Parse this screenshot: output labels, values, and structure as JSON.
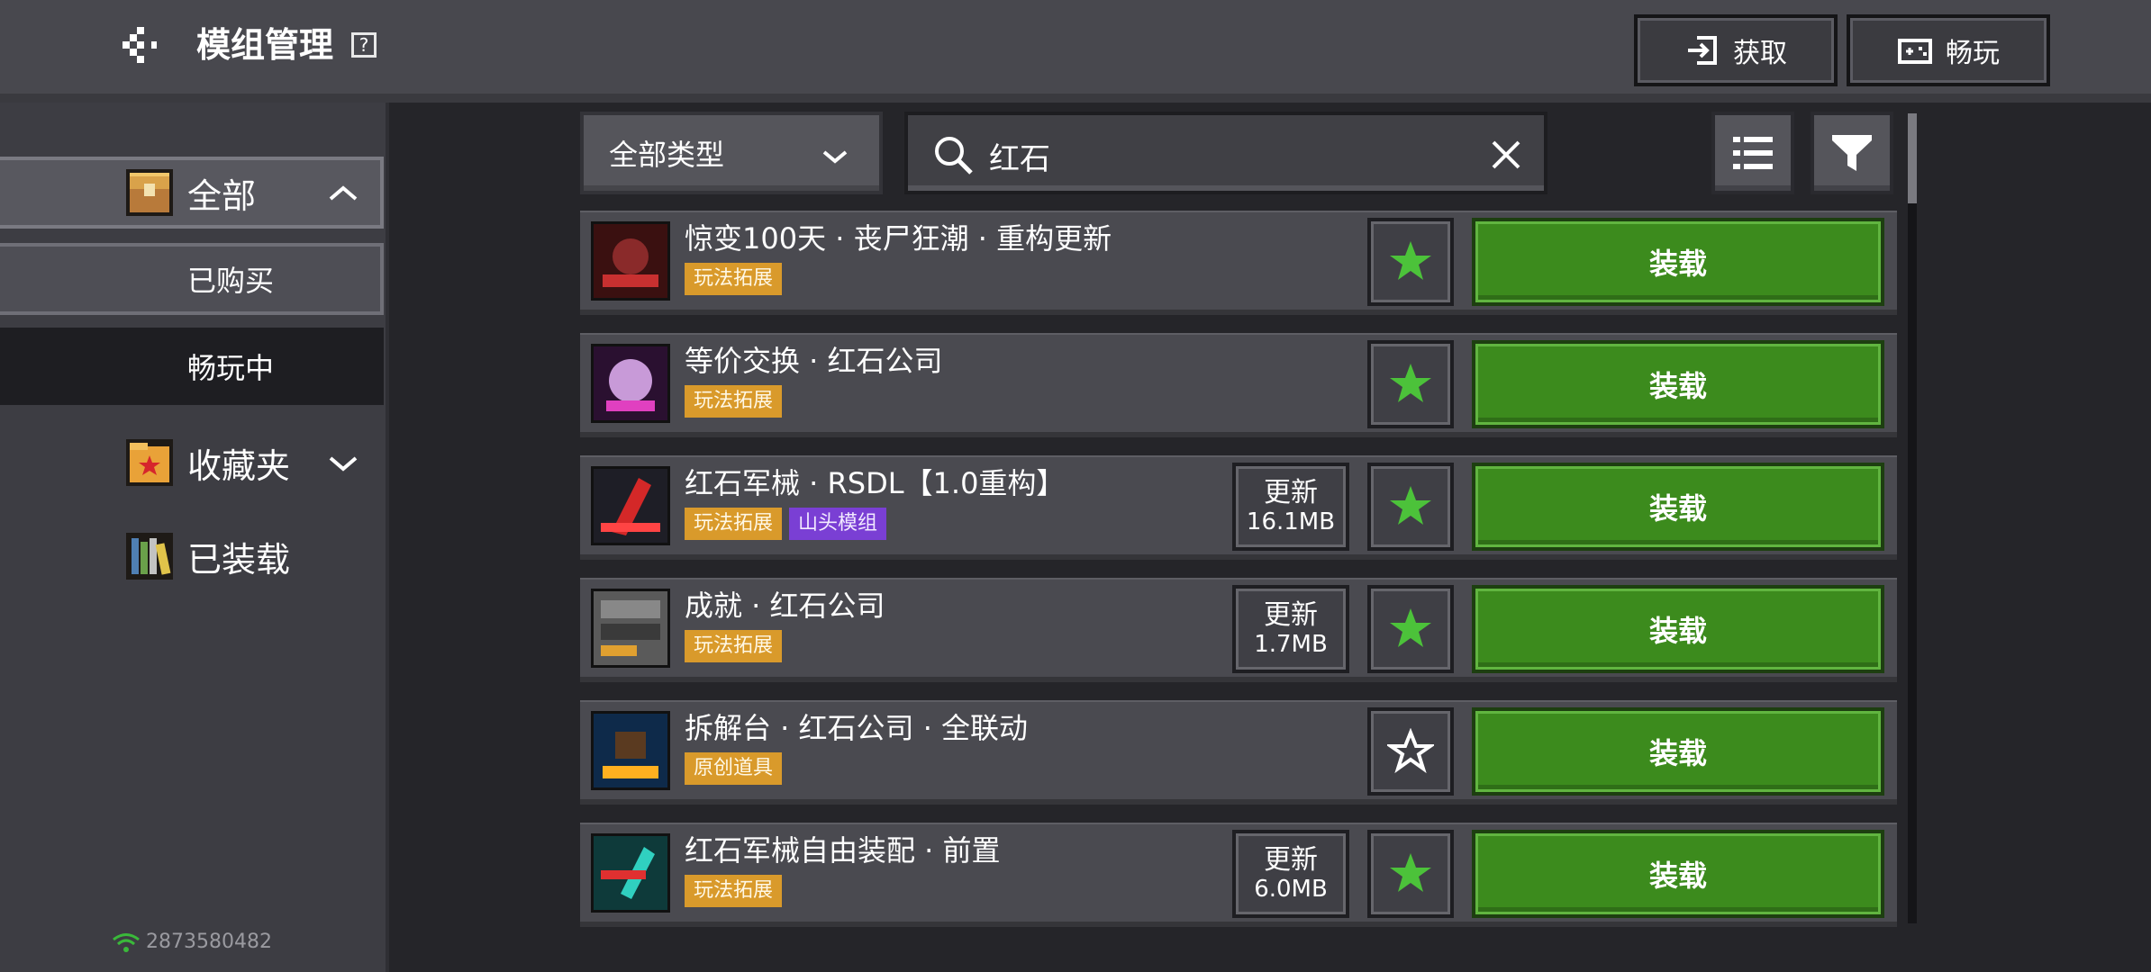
{
  "header": {
    "title": "模组管理",
    "help_label": "?",
    "get_label": "获取",
    "play_label": "畅玩"
  },
  "sidebar": {
    "items": [
      {
        "label": "全部"
      },
      {
        "label": "已购买"
      },
      {
        "label": "畅玩中"
      },
      {
        "label": "收藏夹"
      },
      {
        "label": "已装载"
      }
    ],
    "account_id": "2873580482"
  },
  "toolbar": {
    "type_filter": "全部类型",
    "search_value": "红石"
  },
  "mods": [
    {
      "title": "惊变100天 · 丧尸狂潮 · 重构更新",
      "tags": [
        "玩法拓展"
      ],
      "favorited": true,
      "install_label": "装载"
    },
    {
      "title": "等价交换 · 红石公司",
      "tags": [
        "玩法拓展"
      ],
      "favorited": true,
      "install_label": "装载"
    },
    {
      "title": "红石军械 · RSDL【1.0重构】",
      "tags": [
        "玩法拓展",
        "山头模组"
      ],
      "update": {
        "label": "更新",
        "size": "16.1MB"
      },
      "favorited": true,
      "install_label": "装载"
    },
    {
      "title": "成就 · 红石公司",
      "tags": [
        "玩法拓展"
      ],
      "update": {
        "label": "更新",
        "size": "1.7MB"
      },
      "favorited": true,
      "install_label": "装载"
    },
    {
      "title": "拆解台 · 红石公司 · 全联动",
      "tags": [
        "原创道具"
      ],
      "favorited": false,
      "install_label": "装载"
    },
    {
      "title": "红石军械自由装配 · 前置",
      "tags": [
        "玩法拓展"
      ],
      "update": {
        "label": "更新",
        "size": "6.0MB"
      },
      "favorited": true,
      "install_label": "装载"
    }
  ],
  "colors": {
    "install_green": "#3c8b1d",
    "star_green": "#4cc23a",
    "tag_orange": "#d99a2b",
    "tag_purple": "#7a3fd4"
  }
}
